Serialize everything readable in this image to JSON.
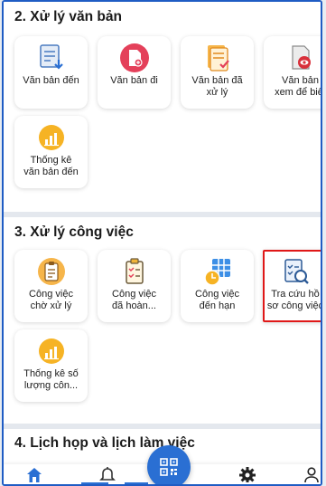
{
  "sections": [
    {
      "title": "2. Xử lý văn bản",
      "items": [
        {
          "label": "Văn bản đến",
          "icon": "incoming-document-icon"
        },
        {
          "label": "Văn bản đi",
          "icon": "outgoing-document-icon"
        },
        {
          "label": "Văn bản đã\nxử lý",
          "icon": "processed-document-icon"
        },
        {
          "label": "Văn bản\nxem để biết",
          "icon": "view-document-icon"
        },
        {
          "label": "Thống kê\nvăn bản đến",
          "icon": "stats-chart-icon"
        }
      ]
    },
    {
      "title": "3. Xử lý công việc",
      "items": [
        {
          "label": "Công việc\nchờ xử lý",
          "icon": "pending-task-icon"
        },
        {
          "label": "Công việc\nđã hoàn...",
          "icon": "completed-task-icon"
        },
        {
          "label": "Công việc\nđến hạn",
          "icon": "due-task-icon"
        },
        {
          "label": "Tra cứu hồ\nsơ công việc",
          "icon": "search-records-icon"
        },
        {
          "label": "Thống kê số\nlượng côn...",
          "icon": "stats-chart-icon"
        }
      ]
    },
    {
      "title": "4. Lịch họp và lịch làm việc"
    }
  ],
  "bottom_nav": {
    "items": [
      "home-icon",
      "bell-icon",
      "qr-code-icon",
      "gear-icon",
      "user-icon"
    ],
    "active": "home-icon"
  },
  "colors": {
    "accent": "#2a6fd3",
    "highlight": "#e01818",
    "frame": "#1f5cc4"
  }
}
